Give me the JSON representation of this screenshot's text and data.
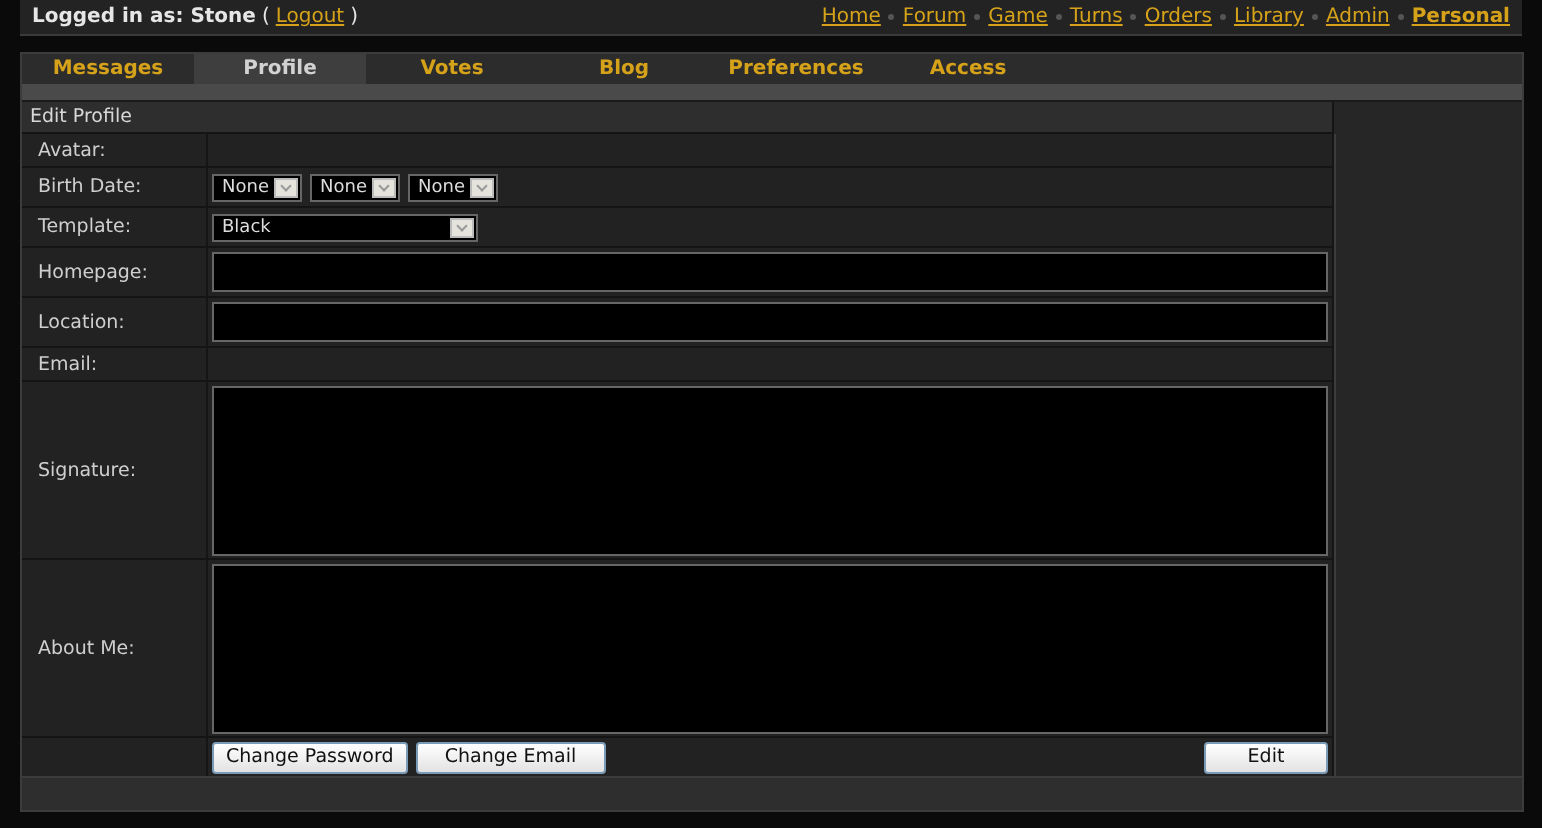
{
  "top_bar": {
    "login_label": "Logged in as: Stone",
    "open_paren": "(",
    "logout_link": "Logout",
    "close_paren": ")",
    "links": [
      {
        "label": "Home",
        "selected": false
      },
      {
        "label": "Forum",
        "selected": false
      },
      {
        "label": "Game",
        "selected": false
      },
      {
        "label": "Turns",
        "selected": false
      },
      {
        "label": "Orders",
        "selected": false
      },
      {
        "label": "Library",
        "selected": false
      },
      {
        "label": "Admin",
        "selected": false
      },
      {
        "label": "Personal",
        "selected": true
      }
    ]
  },
  "tabs": [
    {
      "label": "Messages",
      "selected": false
    },
    {
      "label": "Profile",
      "selected": true
    },
    {
      "label": "Votes",
      "selected": false
    },
    {
      "label": "Blog",
      "selected": false
    },
    {
      "label": "Preferences",
      "selected": false
    },
    {
      "label": "Access",
      "selected": false
    }
  ],
  "form": {
    "title": "Edit Profile",
    "rows": [
      {
        "label": "Avatar:",
        "kind": "empty"
      },
      {
        "label": "Birth Date:",
        "kind": "dates",
        "values": [
          "None",
          "None",
          "None"
        ]
      },
      {
        "label": "Template:",
        "kind": "select",
        "value": "Black"
      },
      {
        "label": "Homepage:",
        "kind": "input"
      },
      {
        "label": "Location:",
        "kind": "input"
      },
      {
        "label": "Email:",
        "kind": "empty"
      },
      {
        "label": "Signature:",
        "kind": "textarea"
      },
      {
        "label": "About Me:",
        "kind": "textarea"
      }
    ],
    "buttons": [
      "Change Password",
      "Change Email"
    ],
    "submit": "Edit"
  }
}
